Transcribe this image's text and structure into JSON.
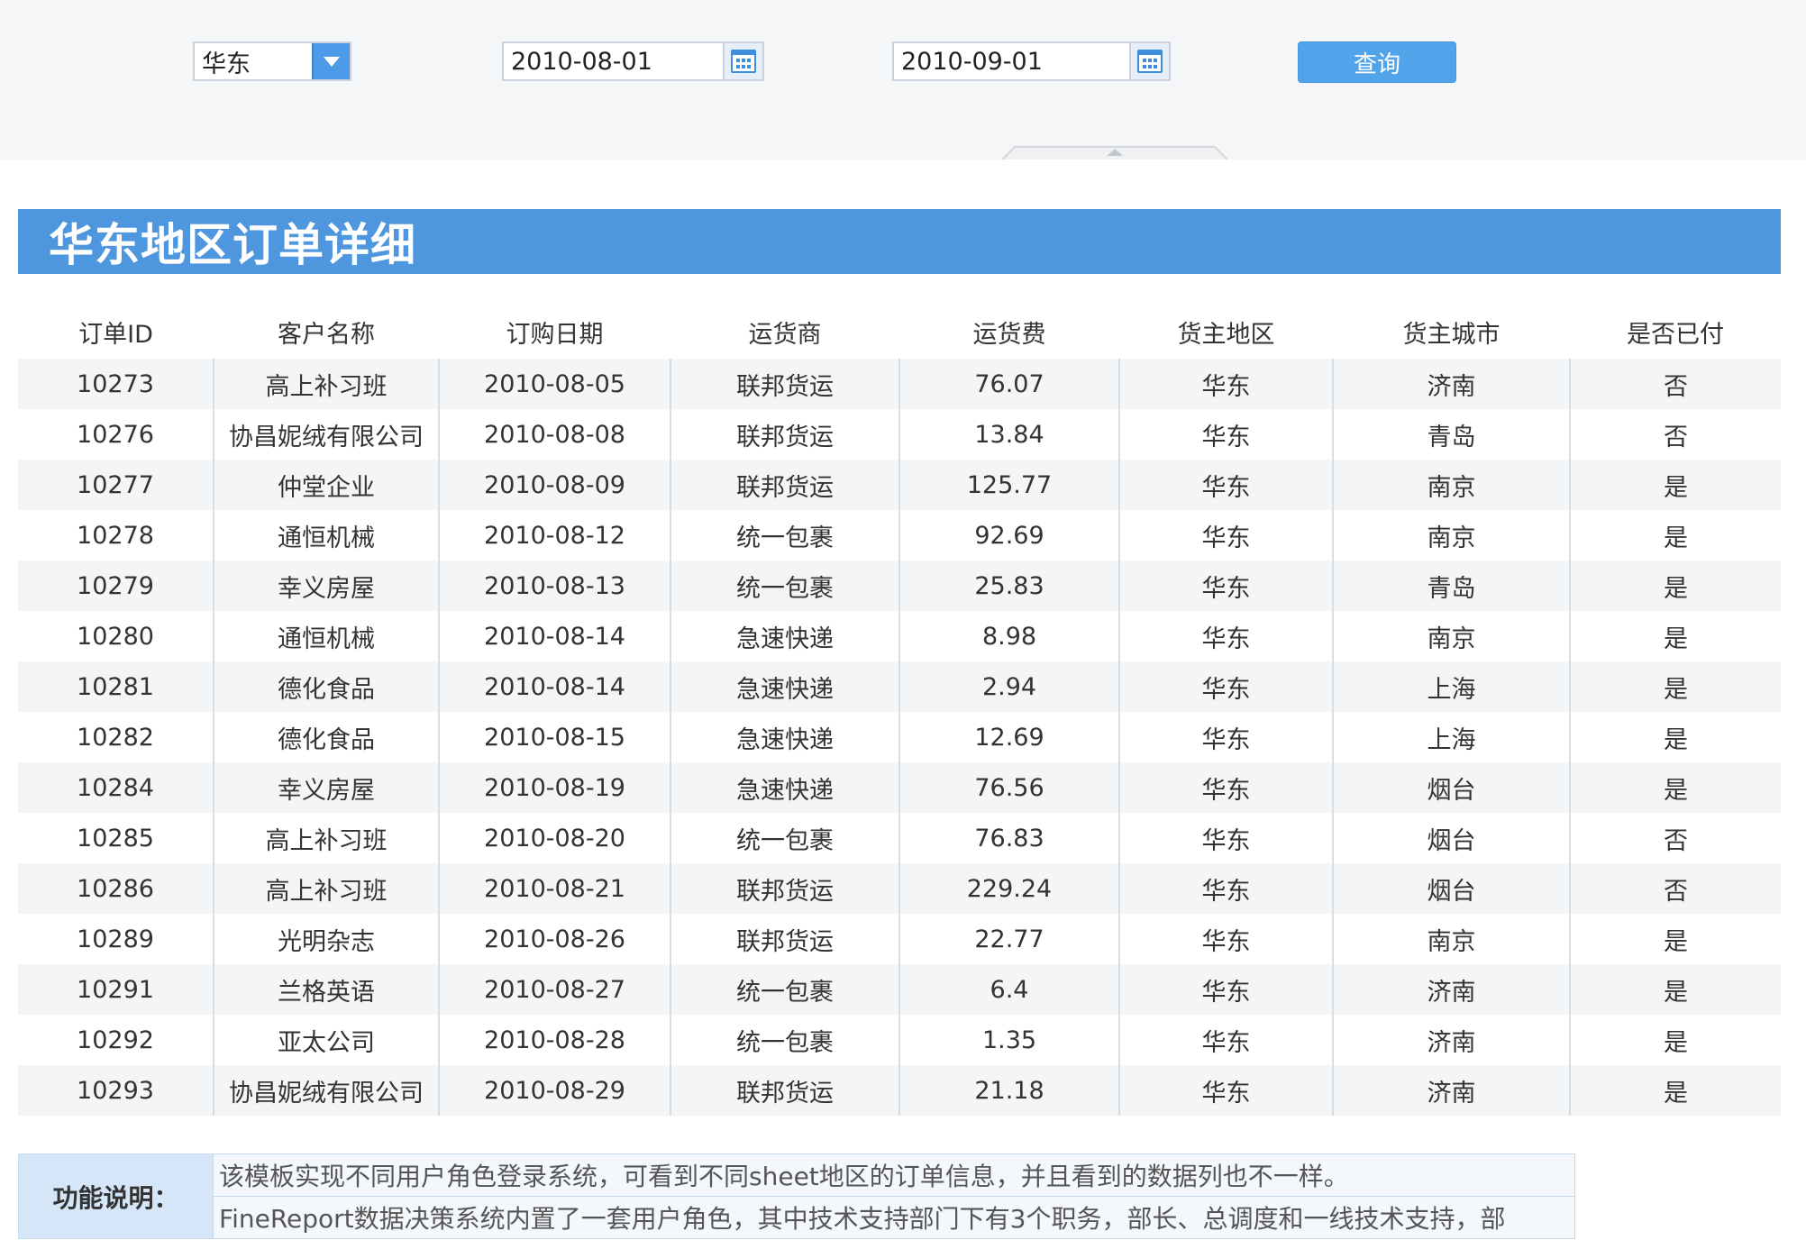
{
  "filters": {
    "region": "华东",
    "start_date": "2010-08-01",
    "end_date": "2010-09-01",
    "query_label": "查询"
  },
  "report": {
    "title": "华东地区订单详细",
    "columns": [
      "订单ID",
      "客户名称",
      "订购日期",
      "运货商",
      "运货费",
      "货主地区",
      "货主城市",
      "是否已付"
    ],
    "rows": [
      [
        "10273",
        "高上补习班",
        "2010-08-05",
        "联邦货运",
        "76.07",
        "华东",
        "济南",
        "否"
      ],
      [
        "10276",
        "协昌妮绒有限公司",
        "2010-08-08",
        "联邦货运",
        "13.84",
        "华东",
        "青岛",
        "否"
      ],
      [
        "10277",
        "仲堂企业",
        "2010-08-09",
        "联邦货运",
        "125.77",
        "华东",
        "南京",
        "是"
      ],
      [
        "10278",
        "通恒机械",
        "2010-08-12",
        "统一包裹",
        "92.69",
        "华东",
        "南京",
        "是"
      ],
      [
        "10279",
        "幸义房屋",
        "2010-08-13",
        "统一包裹",
        "25.83",
        "华东",
        "青岛",
        "是"
      ],
      [
        "10280",
        "通恒机械",
        "2010-08-14",
        "急速快递",
        "8.98",
        "华东",
        "南京",
        "是"
      ],
      [
        "10281",
        "德化食品",
        "2010-08-14",
        "急速快递",
        "2.94",
        "华东",
        "上海",
        "是"
      ],
      [
        "10282",
        "德化食品",
        "2010-08-15",
        "急速快递",
        "12.69",
        "华东",
        "上海",
        "是"
      ],
      [
        "10284",
        "幸义房屋",
        "2010-08-19",
        "急速快递",
        "76.56",
        "华东",
        "烟台",
        "是"
      ],
      [
        "10285",
        "高上补习班",
        "2010-08-20",
        "统一包裹",
        "76.83",
        "华东",
        "烟台",
        "否"
      ],
      [
        "10286",
        "高上补习班",
        "2010-08-21",
        "联邦货运",
        "229.24",
        "华东",
        "烟台",
        "否"
      ],
      [
        "10289",
        "光明杂志",
        "2010-08-26",
        "联邦货运",
        "22.77",
        "华东",
        "南京",
        "是"
      ],
      [
        "10291",
        "兰格英语",
        "2010-08-27",
        "统一包裹",
        "6.4",
        "华东",
        "济南",
        "是"
      ],
      [
        "10292",
        "亚太公司",
        "2010-08-28",
        "统一包裹",
        "1.35",
        "华东",
        "济南",
        "是"
      ],
      [
        "10293",
        "协昌妮绒有限公司",
        "2010-08-29",
        "联邦货运",
        "21.18",
        "华东",
        "济南",
        "是"
      ]
    ]
  },
  "description": {
    "label": "功能说明：",
    "lines": [
      "该模板实现不同用户角色登录系统，可看到不同sheet地区的订单信息，并且看到的数据列也不一样。",
      "FineReport数据决策系统内置了一套用户角色，其中技术支持部门下有3个职务，部长、总调度和一线技术支持，部"
    ]
  },
  "colors": {
    "accent": "#4e97de",
    "button": "#52a4ea",
    "row_stripe": "#f3f5f7",
    "label_bg": "#d4e6f8"
  },
  "icons": {
    "dropdown": "chevron-down-icon",
    "calendar": "calendar-icon",
    "collapse": "collapse-up-icon"
  }
}
